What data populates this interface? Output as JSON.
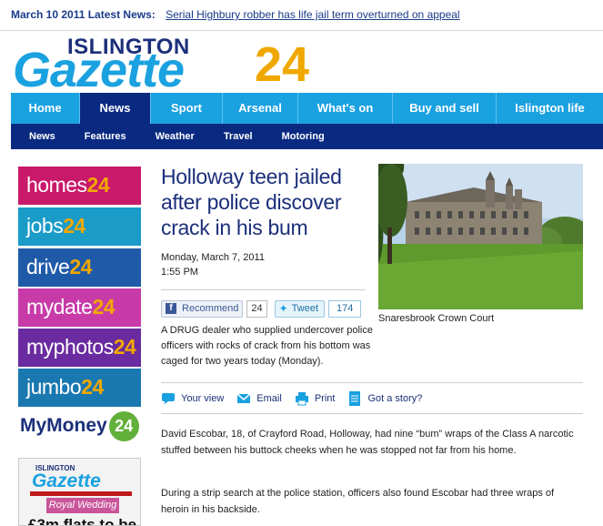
{
  "ticker": {
    "label": "March 10 2011 Latest News:",
    "headline": "Serial Highbury robber has life jail term overturned on appeal"
  },
  "masthead": {
    "top": "ISLINGTON",
    "name": "Gazette",
    "num": "24"
  },
  "nav": {
    "items": [
      {
        "label": "Home"
      },
      {
        "label": "News"
      },
      {
        "label": "Sport"
      },
      {
        "label": "Arsenal"
      },
      {
        "label": "What's on"
      },
      {
        "label": "Buy and sell"
      },
      {
        "label": "Islington life"
      }
    ],
    "active": "News",
    "sub": [
      {
        "label": "News"
      },
      {
        "label": "Features"
      },
      {
        "label": "Weather"
      },
      {
        "label": "Travel"
      },
      {
        "label": "Motoring"
      }
    ]
  },
  "sidebar": {
    "tiles": [
      {
        "word": "homes",
        "num": "24",
        "color": "#c9196a"
      },
      {
        "word": "jobs",
        "num": "24",
        "color": "#1a9bc8"
      },
      {
        "word": "drive",
        "num": "24",
        "color": "#1f5aa8"
      },
      {
        "word": "mydate",
        "num": "24",
        "color": "#c73aa8"
      },
      {
        "word": "myphotos",
        "num": "24",
        "color": "#6a2aa0"
      },
      {
        "word": "jumbo",
        "num": "24",
        "color": "#1a78b0"
      }
    ],
    "mymoney": {
      "word": "MyMoney",
      "num": "24"
    },
    "paper": {
      "top": "ISLINGTON",
      "name": "Gazette",
      "banner": "Royal Wedding",
      "headline": "£3m flats to be"
    }
  },
  "article": {
    "headline": "Holloway teen jailed after police discover crack in his bum",
    "date": "Monday, March 7, 2011",
    "time": "1:55 PM",
    "recommend_label": "Recommend",
    "recommend_count": "24",
    "tweet_label": "Tweet",
    "tweet_count": "174",
    "photo_caption": "Snaresbrook Crown Court",
    "intro": "A DRUG dealer who supplied undercover police officers with rocks of crack from his bottom was caged for two years today (Monday).",
    "tools": {
      "view": "Your view",
      "email": "Email",
      "print": "Print",
      "story": "Got a story?"
    },
    "paragraphs": [
      "David Escobar, 18, of Crayford Road, Holloway, had nine “bum” wraps of the Class A narcotic stuffed between his buttock cheeks when he was stopped not far from his home.",
      "During a strip search at the police station, officers also found Escobar had three wraps of heroin in his backside."
    ]
  }
}
